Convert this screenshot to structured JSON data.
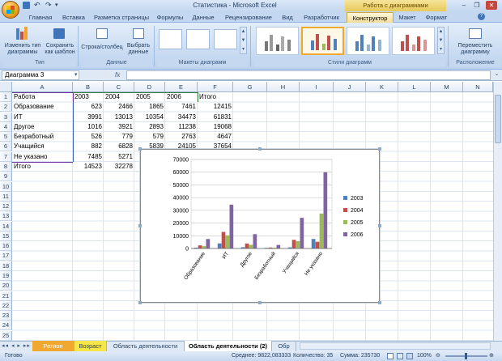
{
  "window": {
    "title": "Статистика - Microsoft Excel",
    "context_title": "Работа с диаграммами"
  },
  "tabs": [
    "Главная",
    "Вставка",
    "Разметка страницы",
    "Формулы",
    "Данные",
    "Рецензирование",
    "Вид",
    "Разработчик",
    "Конструктор",
    "Макет",
    "Формат"
  ],
  "active_tab": "Конструктор",
  "ribbon": {
    "type_group": {
      "label": "Тип",
      "change_type": "Изменить тип диаграммы",
      "save_template": "Сохранить как шаблон"
    },
    "data_group": {
      "label": "Данные",
      "row_col": "Строка/столбец",
      "select_data": "Выбрать данные"
    },
    "layouts_group": {
      "label": "Макеты диаграмм"
    },
    "styles_group": {
      "label": "Стили диаграмм"
    },
    "location_group": {
      "label": "Расположение",
      "move_chart": "Переместить диаграмму"
    }
  },
  "formula_bar": {
    "name_box": "Диаграмма 3",
    "fx": "fx",
    "value": ""
  },
  "columns": [
    "A",
    "B",
    "C",
    "D",
    "E",
    "F",
    "G",
    "H",
    "I",
    "J",
    "K",
    "L",
    "M",
    "N"
  ],
  "rows": [
    "1",
    "2",
    "3",
    "4",
    "5",
    "6",
    "7",
    "8",
    "9",
    "10",
    "11",
    "12",
    "13",
    "14",
    "15",
    "16",
    "17",
    "18",
    "19",
    "20",
    "21",
    "22",
    "23",
    "24",
    "25"
  ],
  "table": {
    "header": [
      "Работа",
      "2003",
      "2004",
      "2005",
      "2006",
      "Итого"
    ],
    "data": [
      [
        "Образование",
        "623",
        "2466",
        "1865",
        "7461",
        "12415"
      ],
      [
        "ИТ",
        "3991",
        "13013",
        "10354",
        "34473",
        "61831"
      ],
      [
        "Другое",
        "1016",
        "3921",
        "2893",
        "11238",
        "19068"
      ],
      [
        "Безработный",
        "526",
        "779",
        "579",
        "2763",
        "4647"
      ],
      [
        "Учащийся",
        "882",
        "6828",
        "5839",
        "24105",
        "37654"
      ],
      [
        "Не указано",
        "7485",
        "5271",
        "",
        "",
        ""
      ]
    ],
    "total": [
      "Итого",
      "14523",
      "32278",
      "",
      "",
      ""
    ]
  },
  "chart_data": {
    "type": "bar",
    "categories": [
      "Образование",
      "ИТ",
      "Другое",
      "Безработный",
      "Учащийся",
      "Не указано"
    ],
    "series": [
      {
        "name": "2003",
        "values": [
          623,
          3991,
          1016,
          526,
          882,
          7485
        ]
      },
      {
        "name": "2004",
        "values": [
          2466,
          13013,
          3921,
          779,
          6828,
          5271
        ]
      },
      {
        "name": "2005",
        "values": [
          1865,
          10354,
          2893,
          579,
          5839,
          27500
        ]
      },
      {
        "name": "2006",
        "values": [
          7461,
          34473,
          11238,
          2763,
          24105,
          60000
        ]
      }
    ],
    "colors": [
      "#4f81bd",
      "#c0504d",
      "#9bbb59",
      "#8064a2"
    ],
    "ylim": [
      0,
      70000
    ],
    "yticks": [
      "0",
      "10000",
      "20000",
      "30000",
      "40000",
      "50000",
      "60000",
      "70000"
    ],
    "grid": true,
    "legend_position": "right"
  },
  "sheet_tabs": [
    "Регион",
    "Возраст",
    "Область деятельности",
    "Область деятельности (2)",
    "Обр"
  ],
  "active_sheet": "Область деятельности (2)",
  "status": {
    "ready": "Готово",
    "average": "Среднее: 9822,083333",
    "count": "Количество: 35",
    "sum": "Сумма: 235730",
    "zoom": "100%"
  }
}
